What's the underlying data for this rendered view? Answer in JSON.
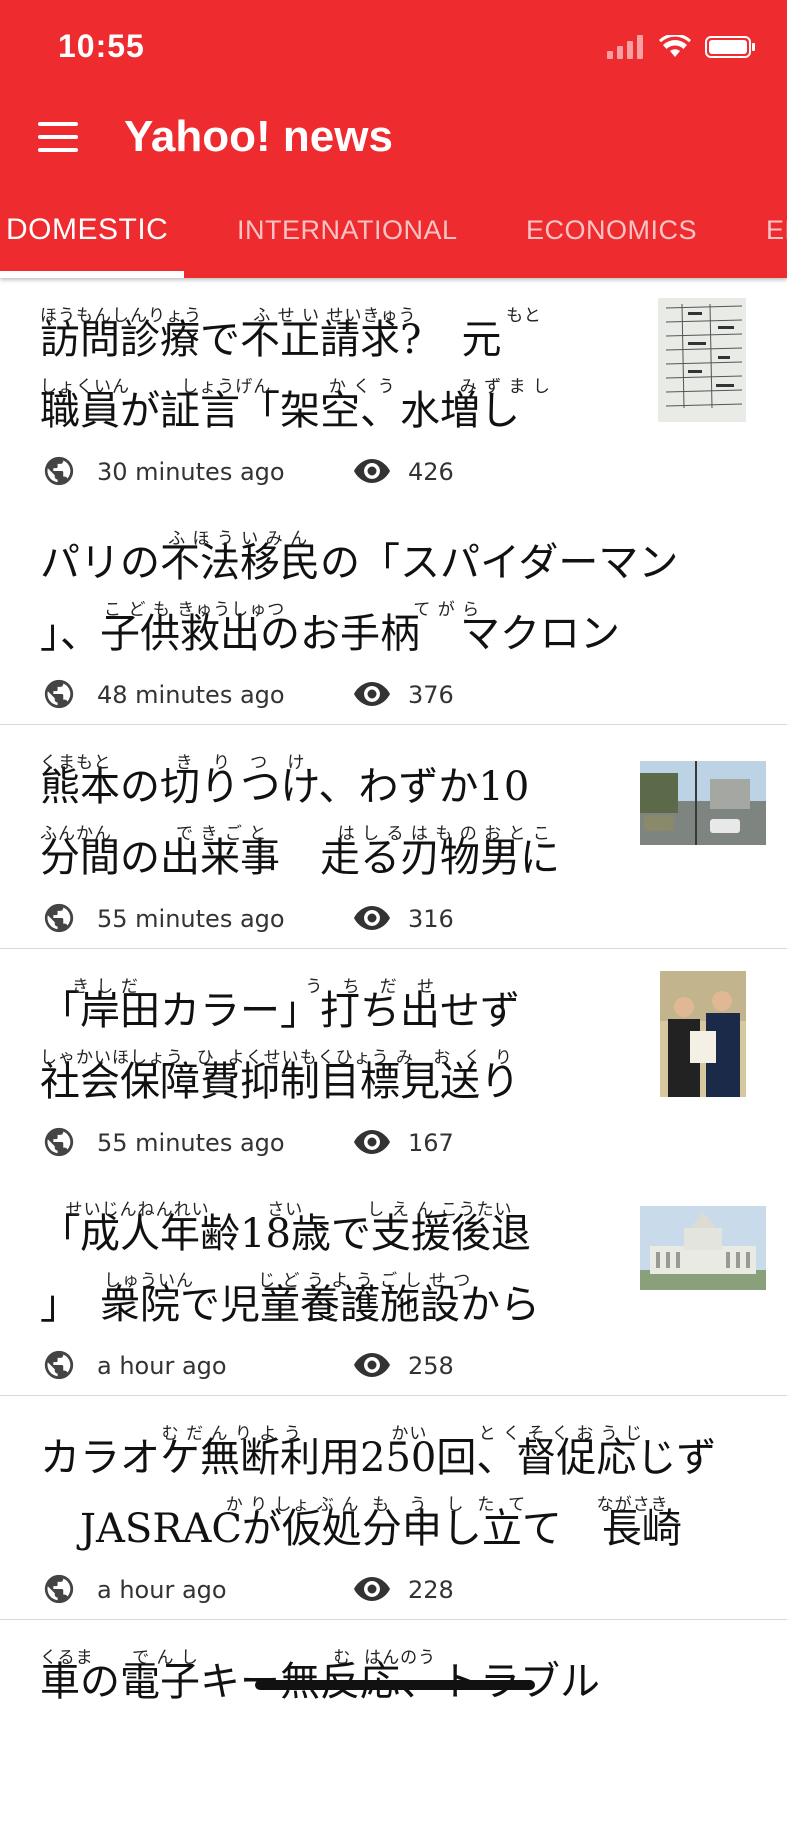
{
  "status_bar": {
    "time": "10:55"
  },
  "app": {
    "title": "Yahoo! news",
    "menu_icon": "hamburger-menu-icon"
  },
  "tabs": [
    {
      "label": "DOMESTIC",
      "active": true
    },
    {
      "label": "INTERNATIONAL",
      "active": false
    },
    {
      "label": "ECONOMICS",
      "active": false
    },
    {
      "label": "EN",
      "active": false
    }
  ],
  "articles": [
    {
      "title_lines": [
        {
          "ruby": "ほうもんしんりょう        ふ せ い せいきゅう              もと",
          "text": "訪問診療で不正請求?　元"
        },
        {
          "ruby": "しょくいん        しょうげん         か く う          み ず ま し",
          "text": "職員が証言「架空、水増し"
        }
      ],
      "time": "30 minutes ago",
      "views": "426",
      "thumbnail": "document-photo"
    },
    {
      "title_lines": [
        {
          "ruby": "                    ふ ほ う い み ん",
          "text": "パリの不法移民の「スパイダーマン"
        },
        {
          "ruby": "          こ ど も きゅうしゅつ                    て が ら",
          "text": "」、子供救出のお手柄　マクロン"
        }
      ],
      "time": "48 minutes ago",
      "views": "376",
      "thumbnail": null
    },
    {
      "title_lines": [
        {
          "ruby": "くまもと          き   り   つ   け",
          "text": "熊本の切りつけ、わずか10"
        },
        {
          "ruby": "ふんかん          で き ご と           は し る は も の お と こ",
          "text": "分間の出来事　走る刃物男に"
        }
      ],
      "time": "55 minutes ago",
      "views": "316",
      "thumbnail": "street-photo"
    },
    {
      "title_lines": [
        {
          "ruby": "     き し だ                          う   ち   だ   せ",
          "text": "「岸田カラー」打ち出せず"
        },
        {
          "ruby": "しゃかいほしょう  ひ  よくせいもくひょう み   お  く  り",
          "text": "社会保障費抑制目標見送り"
        }
      ],
      "time": "55 minutes ago",
      "views": "167",
      "thumbnail": "politicians-photo"
    },
    {
      "title_lines": [
        {
          "ruby": "    せいじんねんれい         さい          し え ん こうたい",
          "text": "「成人年齢18歳で支援後退"
        },
        {
          "ruby": "          しゅういん          じ ど う よ う ご し せ つ",
          "text": "」　衆院で児童養護施設から"
        }
      ],
      "time": "a hour ago",
      "views": "258",
      "thumbnail": "parliament-photo"
    },
    {
      "title_lines": [
        {
          "ruby": "                   む だ ん り よ う              かい        と く そ く お う じ",
          "text": "カラオケ無断利用250回、督促応じず"
        },
        {
          "ruby": "                             か り しょ ぶ ん  も   う   し  た  て           ながさき",
          "text": "　JASRACが仮処分申し立て　長崎"
        }
      ],
      "time": "a hour ago",
      "views": "228",
      "thumbnail": null
    },
    {
      "title_lines": [
        {
          "ruby": "くるま      で ん し                     む  はんのう",
          "text": "車の電子キー無反応、トラブル"
        }
      ],
      "time": "",
      "views": "",
      "thumbnail": null
    }
  ]
}
